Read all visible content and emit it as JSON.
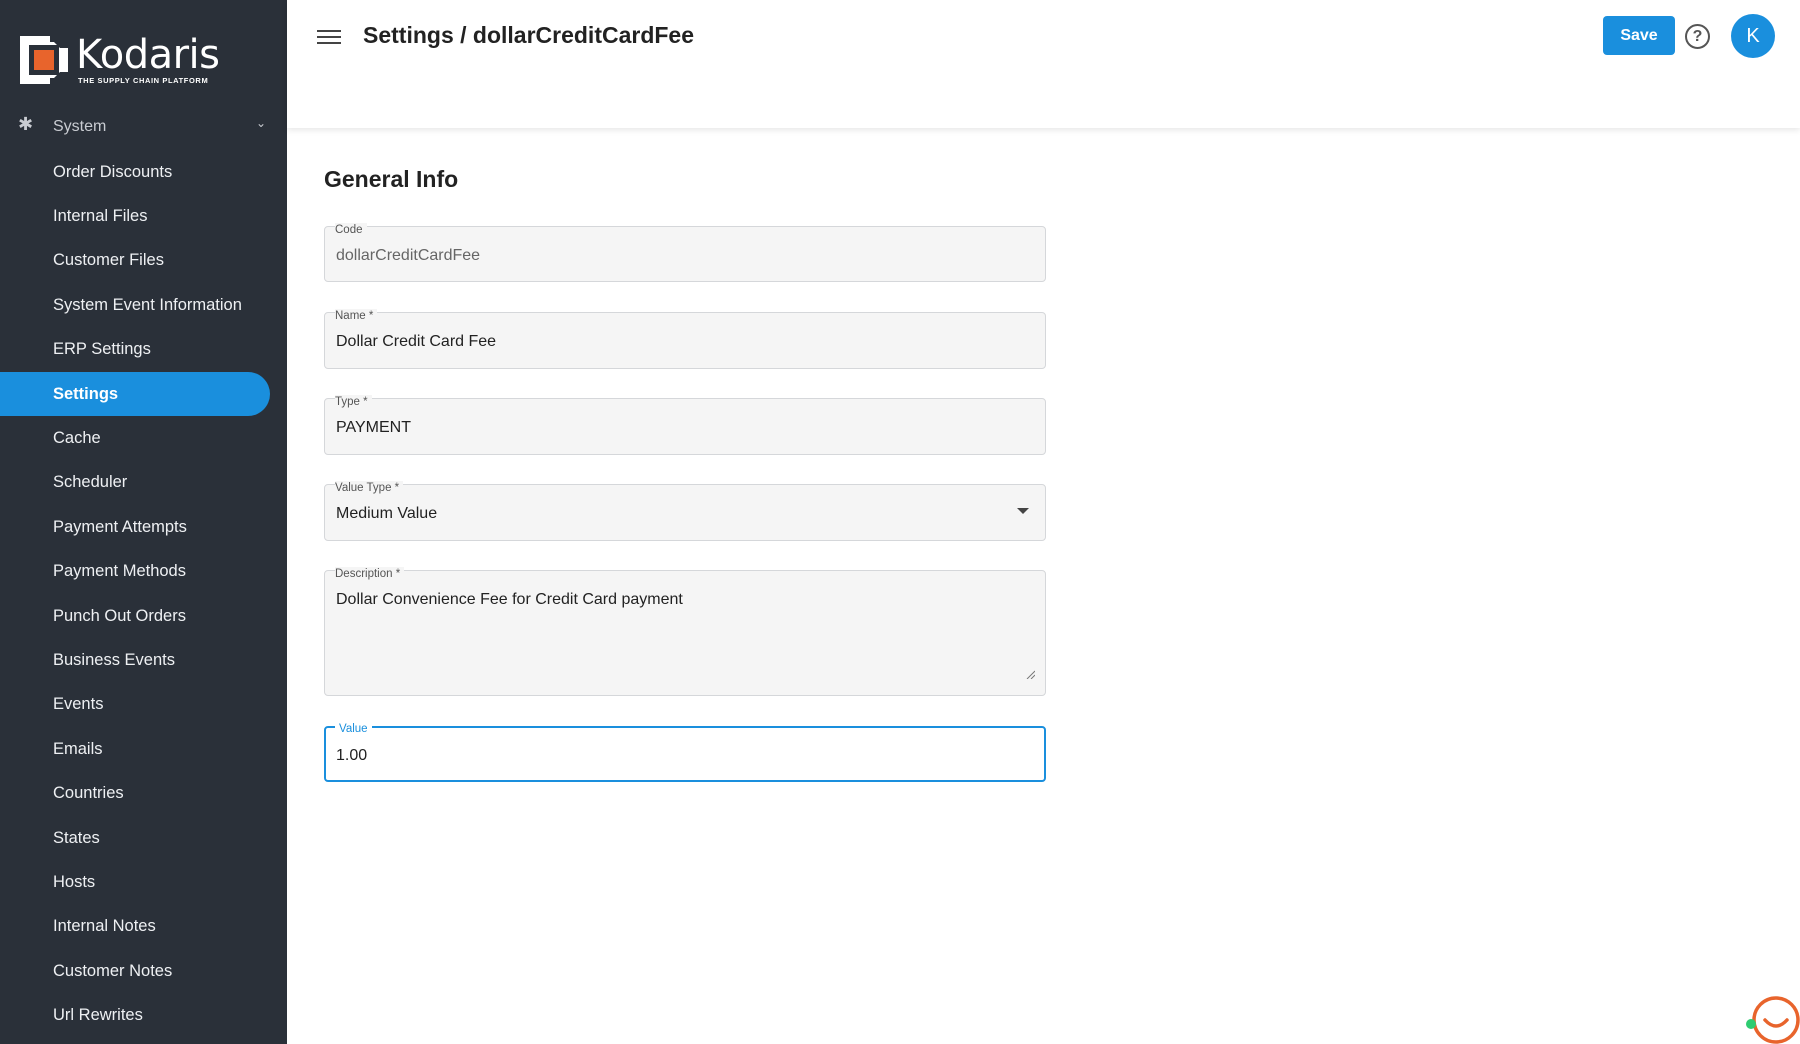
{
  "brand": {
    "name": "Kodaris",
    "tagline": "THE SUPPLY CHAIN PLATFORM",
    "accent_color": "#1a8fdd",
    "logo_color": "#e8642c"
  },
  "sidebar": {
    "group_label": "System",
    "items": [
      {
        "label": "Order Discounts"
      },
      {
        "label": "Internal Files"
      },
      {
        "label": "Customer Files"
      },
      {
        "label": "System Event Information"
      },
      {
        "label": "ERP Settings"
      },
      {
        "label": "Settings",
        "active": true
      },
      {
        "label": "Cache"
      },
      {
        "label": "Scheduler"
      },
      {
        "label": "Payment Attempts"
      },
      {
        "label": "Payment Methods"
      },
      {
        "label": "Punch Out Orders"
      },
      {
        "label": "Business Events"
      },
      {
        "label": "Events"
      },
      {
        "label": "Emails"
      },
      {
        "label": "Countries"
      },
      {
        "label": "States"
      },
      {
        "label": "Hosts"
      },
      {
        "label": "Internal Notes"
      },
      {
        "label": "Customer Notes"
      },
      {
        "label": "Url Rewrites"
      }
    ]
  },
  "header": {
    "title": "Settings / dollarCreditCardFee",
    "save_label": "Save",
    "help_glyph": "?",
    "avatar_initial": "K"
  },
  "form": {
    "section_title": "General Info",
    "code": {
      "label": "Code",
      "value": "dollarCreditCardFee"
    },
    "name": {
      "label": "Name *",
      "value": "Dollar Credit Card Fee"
    },
    "type": {
      "label": "Type *",
      "value": "PAYMENT"
    },
    "value_type": {
      "label": "Value Type *",
      "value": "Medium Value"
    },
    "description": {
      "label": "Description *",
      "value": "Dollar Convenience Fee for Credit Card payment"
    },
    "value": {
      "label": "Value",
      "value": "1.00"
    }
  }
}
